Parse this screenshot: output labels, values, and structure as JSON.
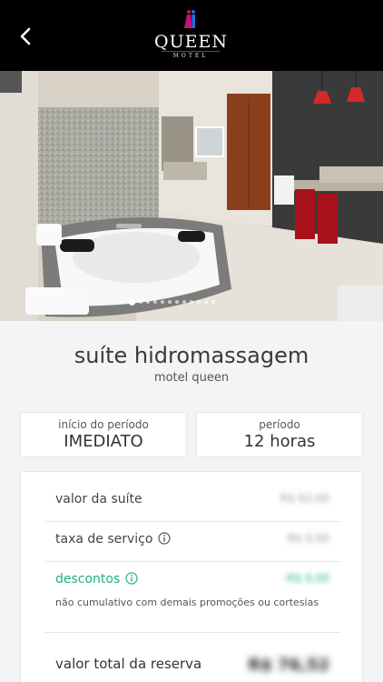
{
  "header": {
    "back_icon": "chevron-left-icon",
    "logo_main": "QUEEN",
    "logo_sub": "MOTEL",
    "accent": "#c2127a"
  },
  "gallery": {
    "image_alt": "suíte hidromassagem",
    "slide_count": 12,
    "active_index": 0
  },
  "suite": {
    "name": "suíte hidromassagem",
    "motel": "motel queen"
  },
  "cards": [
    {
      "label": "início do período",
      "value": "IMEDIATO"
    },
    {
      "label": "período",
      "value": "12 horas"
    }
  ],
  "pricing": {
    "rows": [
      {
        "label": "valor da suíte",
        "amount": "R$ 62,00"
      },
      {
        "label": "taxa de serviço",
        "amount": "R$ 0,00",
        "info_icon": "info-icon"
      },
      {
        "label": "descontos",
        "amount": "-R$ 0,00",
        "info_icon": "info-icon",
        "color": "#1fb27a"
      }
    ],
    "note": "não cumulativo com demais promoções ou cortesias",
    "total_label": "valor total da reserva",
    "total_amount": "R$ 76,52"
  }
}
